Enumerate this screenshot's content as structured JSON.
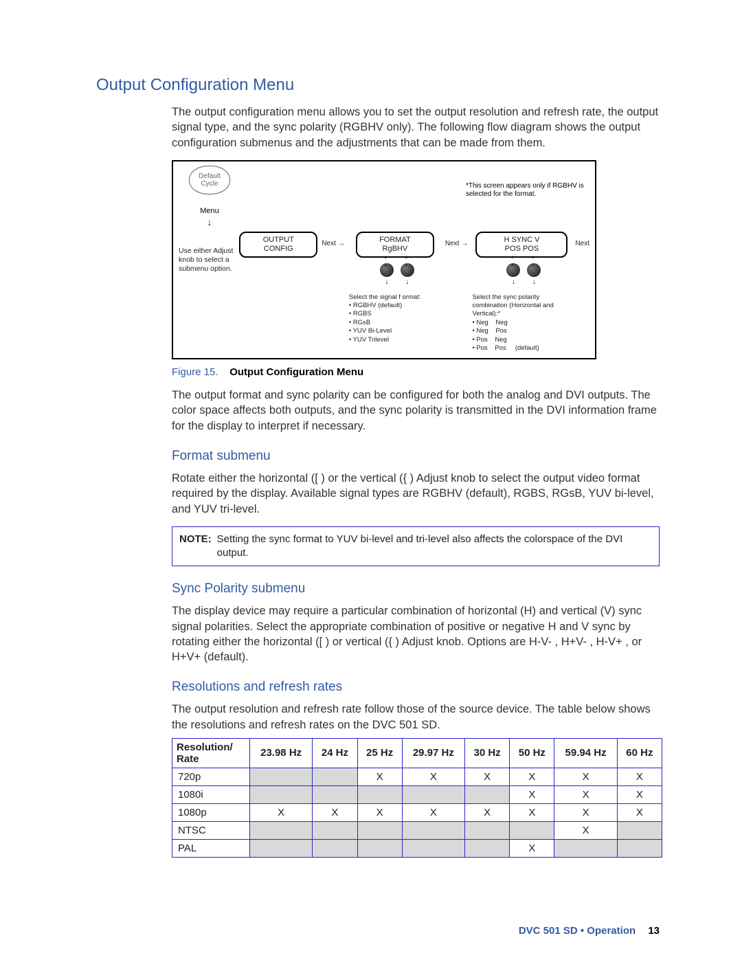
{
  "h1": "Output Configuration Menu",
  "intro": "The output configuration menu allows you to set the output resolution and refresh rate, the output signal type, and the sync polarity (RGBHV only). The following flow diagram shows the output configuration submenus and the adjustments that can be made from them.",
  "diagram": {
    "default_cycle_l1": "Default",
    "default_cycle_l2": "Cycle",
    "menu_label": "Menu",
    "note_top": "*This screen appears only if RGBHV is selected for the format.",
    "knob_note": "Use either Adjust knob to select a submenu option.",
    "box1_l1": "OUTPUT",
    "box1_l2": "CONFIG",
    "next": "Next",
    "box2_l1": "FORMAT",
    "box2_l2": "RgBHV",
    "box3_l1": "H    SYNC    V",
    "box3_l2": "POS        POS",
    "fmt_sub_title": "Select the signal f  ormat:",
    "fmt_sub_lines": "• RGBHV (default)\n• RGBS\n• RGsB\n• YUV Bi-Level\n• YUV Trilevel",
    "sync_sub_title": "Select the sync polarity combination (Horizontal and Vertical):*",
    "sync_sub_lines": "• Neg    Neg\n• Neg    Pos\n• Pos    Neg\n• Pos    Pos     (default)"
  },
  "figure_caption": {
    "label": "Figure 15.",
    "title": "Output Configuration Menu"
  },
  "para2": "The output format and sync polarity can be configured for both the analog and DVI outputs. The color space affects both outputs, and the sync polarity is transmitted in the DVI information frame for the display to interpret if necessary.",
  "h2_format": "Format submenu",
  "format_para": "Rotate either the horizontal ([ ) or the vertical ({ ) Adjust knob to select the output video format required by the display. Available signal types are RGBHV (default), RGBS, RGsB, YUV bi-level, and YUV tri-level.",
  "note": {
    "tag": "NOTE:",
    "text": "Setting the sync format to YUV bi-level and tri-level also affects the colorspace of the DVI output."
  },
  "h2_sync": "Sync Polarity submenu",
  "sync_para": "The display device may require a particular combination of horizontal (H) and vertical (V) sync signal polarities. Select the appropriate combination of positive or negative H and V sync by rotating either the horizontal ([ ) or vertical ({ ) Adjust knob. Options are H-V- , H+V- , H-V+ , or H+V+ (default).",
  "h2_res": "Resolutions and refresh rates",
  "res_para": "The output resolution and refresh rate follow those of the source device. The table below shows the resolutions and refresh rates on the DVC 501 SD.",
  "table": {
    "head_rowlabel": "Resolution/\nRate",
    "cols": [
      "23.98 Hz",
      "24 Hz",
      "25 Hz",
      "29.97 Hz",
      "30 Hz",
      "50 Hz",
      "59.94 Hz",
      "60 Hz"
    ],
    "rows": [
      {
        "name": "720p",
        "c": [
          "G",
          "G",
          "X",
          "X",
          "X",
          "X",
          "X",
          "X"
        ]
      },
      {
        "name": "1080i",
        "c": [
          "G",
          "G",
          "G",
          "G",
          "G",
          "X",
          "X",
          "X"
        ]
      },
      {
        "name": "1080p",
        "c": [
          "X",
          "X",
          "X",
          "X",
          "X",
          "X",
          "X",
          "X"
        ]
      },
      {
        "name": "NTSC",
        "c": [
          "G",
          "G",
          "G",
          "G",
          "G",
          "G",
          "X",
          "G"
        ]
      },
      {
        "name": "PAL",
        "c": [
          "G",
          "G",
          "G",
          "G",
          "G",
          "X",
          "G",
          "G"
        ]
      }
    ]
  },
  "footer": {
    "doc": "DVC 501 SD • Operation",
    "page": "13"
  },
  "chart_data": {
    "type": "table",
    "title": "Resolutions and refresh rates supported",
    "columns": [
      "Resolution/Rate",
      "23.98 Hz",
      "24 Hz",
      "25 Hz",
      "29.97 Hz",
      "30 Hz",
      "50 Hz",
      "59.94 Hz",
      "60 Hz"
    ],
    "rows": [
      [
        "720p",
        null,
        null,
        true,
        true,
        true,
        true,
        true,
        true
      ],
      [
        "1080i",
        null,
        null,
        null,
        null,
        null,
        true,
        true,
        true
      ],
      [
        "1080p",
        true,
        true,
        true,
        true,
        true,
        true,
        true,
        true
      ],
      [
        "NTSC",
        null,
        null,
        null,
        null,
        null,
        null,
        true,
        null
      ],
      [
        "PAL",
        null,
        null,
        null,
        null,
        null,
        true,
        null,
        null
      ]
    ],
    "legend": {
      "true": "X (supported)",
      "null": "greyed (not applicable)"
    }
  }
}
